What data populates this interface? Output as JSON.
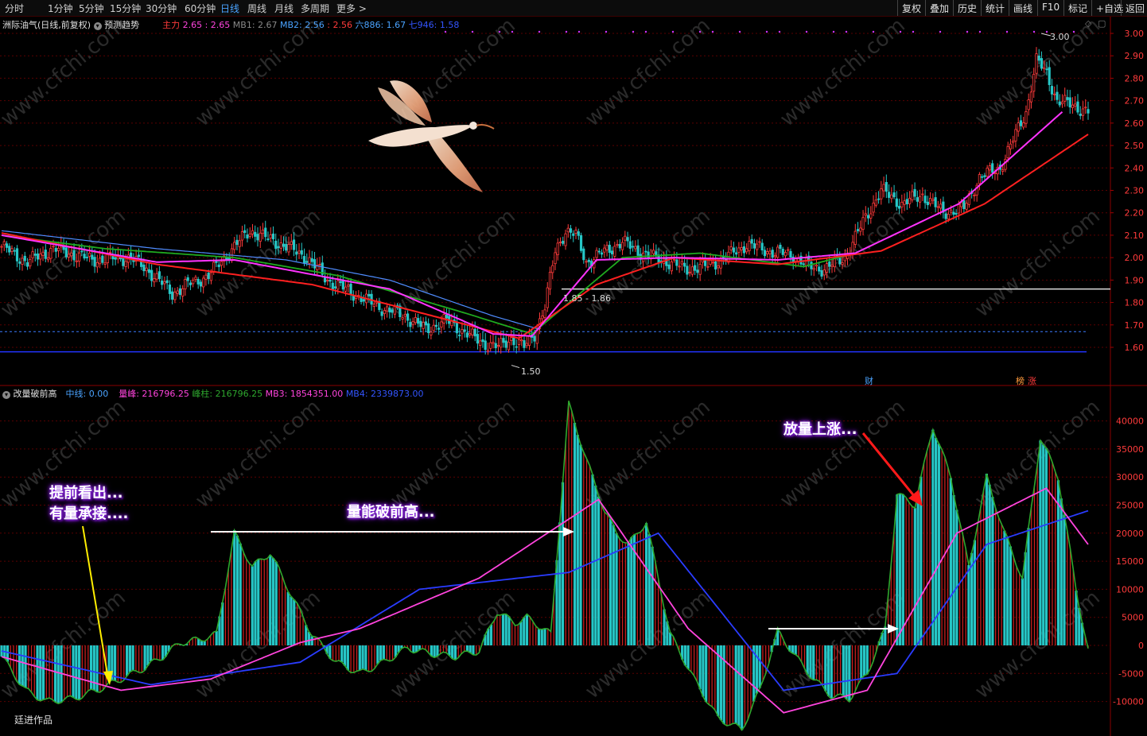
{
  "toolbar": {
    "periods": [
      "分时",
      "1分钟",
      "5分钟",
      "15分钟",
      "30分钟",
      "60分钟",
      "日线",
      "周线",
      "月线",
      "多周期",
      "更多 >"
    ],
    "active_period": "日线",
    "right_buttons": [
      "复权",
      "叠加",
      "历史",
      "统计",
      "画线",
      "F10",
      "标记",
      "+自选",
      "返回"
    ]
  },
  "main_info": {
    "title": "洲际油气(日线,前复权)",
    "trend_label": "预测趋势",
    "zhuli_label": "主力",
    "zhuli_val": "2.65 : 2.65",
    "mb1": "MB1: 2.67",
    "mb2_label": "MB2: 2.56",
    "mb2_val": ": 2.56",
    "liu": "六886: 1.67",
    "qi": "七946: 1.58"
  },
  "sub_info": {
    "title": "改量破前高",
    "zhongxian": "中线: 0.00",
    "liangfeng": "量峰: 216796.25",
    "fengzhu": "峰柱: 216796.25",
    "mb3": "MB3: 1854351.00",
    "mb4": "MB4: 2339873.00"
  },
  "tags": {
    "cai": "财",
    "bang": "榜",
    "zhang": "涨",
    "range": "1.85 - 1.86",
    "high": "3.00",
    "low": "1.50",
    "author": "廷进作品"
  },
  "annotations": {
    "a1_line1": "提前看出...",
    "a1_line2": "有量承接....",
    "a2": "量能破前高...",
    "a3": "放量上涨..."
  },
  "colors": {
    "up": "#ff3b3b",
    "down": "#26c6c6",
    "ma_red": "#ff2020",
    "ma_magenta": "#ff33ff",
    "ma_green": "#1faa1f",
    "ma_blue": "#4f8cff",
    "vol_green_line": "#2ea82e",
    "sub_magenta": "#ff44dd",
    "sub_blue": "#2a3cff"
  },
  "chart_data": [
    {
      "type": "candlestick",
      "title": "洲际油气(日线,前复权)",
      "y_ticks": [
        "3.00",
        "2.90",
        "2.80",
        "2.70",
        "2.60",
        "2.50",
        "2.40",
        "2.30",
        "2.20",
        "2.10",
        "2.00",
        "1.90",
        "1.80",
        "1.70",
        "1.60"
      ],
      "ylim": [
        1.55,
        3.02
      ],
      "price_points": [
        [
          0,
          2.05
        ],
        [
          10,
          1.98
        ],
        [
          20,
          2.04
        ],
        [
          35,
          1.99
        ],
        [
          50,
          2.0
        ],
        [
          58,
          1.93
        ],
        [
          66,
          1.84
        ],
        [
          72,
          1.88
        ],
        [
          80,
          1.92
        ],
        [
          90,
          2.05
        ],
        [
          96,
          2.12
        ],
        [
          102,
          2.09
        ],
        [
          110,
          2.05
        ],
        [
          118,
          2.0
        ],
        [
          126,
          1.9
        ],
        [
          136,
          1.84
        ],
        [
          146,
          1.78
        ],
        [
          156,
          1.74
        ],
        [
          164,
          1.68
        ],
        [
          172,
          1.72
        ],
        [
          180,
          1.66
        ],
        [
          186,
          1.62
        ],
        [
          192,
          1.6
        ],
        [
          197,
          1.64
        ],
        [
          202,
          1.6
        ],
        [
          206,
          1.66
        ],
        [
          210,
          1.78
        ],
        [
          214,
          2.03
        ],
        [
          218,
          2.12
        ],
        [
          222,
          2.1
        ],
        [
          226,
          1.98
        ],
        [
          232,
          2.02
        ],
        [
          240,
          2.07
        ],
        [
          246,
          2.03
        ],
        [
          252,
          2.0
        ],
        [
          258,
          1.98
        ],
        [
          264,
          1.95
        ],
        [
          272,
          1.96
        ],
        [
          280,
          2.0
        ],
        [
          288,
          2.06
        ],
        [
          296,
          2.03
        ],
        [
          306,
          2.01
        ],
        [
          312,
          1.96
        ],
        [
          318,
          1.95
        ],
        [
          326,
          2.0
        ],
        [
          334,
          2.18
        ],
        [
          340,
          2.3
        ],
        [
          348,
          2.24
        ],
        [
          356,
          2.28
        ],
        [
          364,
          2.2
        ],
        [
          372,
          2.22
        ],
        [
          378,
          2.36
        ],
        [
          386,
          2.4
        ],
        [
          392,
          2.55
        ],
        [
          396,
          2.65
        ],
        [
          400,
          2.88
        ],
        [
          404,
          2.82
        ],
        [
          408,
          2.7
        ],
        [
          414,
          2.68
        ],
        [
          420,
          2.65
        ]
      ],
      "ma_fast_points": [
        [
          0,
          2.1
        ],
        [
          60,
          1.98
        ],
        [
          90,
          1.99
        ],
        [
          150,
          1.86
        ],
        [
          190,
          1.66
        ],
        [
          205,
          1.65
        ],
        [
          230,
          1.99
        ],
        [
          260,
          2.0
        ],
        [
          300,
          1.99
        ],
        [
          330,
          2.02
        ],
        [
          370,
          2.24
        ],
        [
          410,
          2.65
        ]
      ],
      "ma_slow_points": [
        [
          0,
          2.11
        ],
        [
          60,
          1.97
        ],
        [
          120,
          1.88
        ],
        [
          180,
          1.7
        ],
        [
          200,
          1.64
        ],
        [
          230,
          1.88
        ],
        [
          260,
          2.0
        ],
        [
          300,
          1.97
        ],
        [
          340,
          2.03
        ],
        [
          380,
          2.24
        ],
        [
          420,
          2.55
        ]
      ],
      "ma_green_points": [
        [
          0,
          2.1
        ],
        [
          40,
          2.04
        ],
        [
          90,
          2.0
        ],
        [
          130,
          1.92
        ],
        [
          180,
          1.75
        ],
        [
          205,
          1.66
        ],
        [
          240,
          2.0
        ],
        [
          270,
          2.02
        ],
        [
          310,
          1.96
        ],
        [
          330,
          2.02
        ]
      ],
      "ma_blue_points": [
        [
          0,
          2.12
        ],
        [
          60,
          2.04
        ],
        [
          110,
          1.99
        ],
        [
          150,
          1.9
        ],
        [
          190,
          1.74
        ],
        [
          208,
          1.68
        ]
      ],
      "horizontal_levels": {
        "range_line": 1.86,
        "dashed_line": 1.67,
        "blue_line": 1.58
      },
      "extremes": {
        "high": 3.0,
        "low": 1.5
      }
    },
    {
      "type": "bar",
      "title": "改量破前高",
      "y_ticks": [
        "40000",
        "35000",
        "30000",
        "25000",
        "20000",
        "15000",
        "10000",
        "5000",
        "0",
        "-5000",
        "-10000"
      ],
      "ylim": [
        -15000,
        44000
      ],
      "bar_points": [
        [
          0,
          -2000
        ],
        [
          8,
          -8000
        ],
        [
          15,
          -10000
        ],
        [
          24,
          -9500
        ],
        [
          32,
          -8000
        ],
        [
          40,
          -6000
        ],
        [
          48,
          -4000
        ],
        [
          54,
          -2000
        ],
        [
          60,
          500
        ],
        [
          66,
          1000
        ],
        [
          72,
          2000
        ],
        [
          78,
          20000
        ],
        [
          84,
          14000
        ],
        [
          90,
          16500
        ],
        [
          98,
          8000
        ],
        [
          104,
          2000
        ],
        [
          112,
          -3000
        ],
        [
          120,
          -5000
        ],
        [
          128,
          -3000
        ],
        [
          136,
          -500
        ],
        [
          144,
          -1500
        ],
        [
          152,
          -2000
        ],
        [
          160,
          -1000
        ],
        [
          166,
          6000
        ],
        [
          172,
          4000
        ],
        [
          176,
          5000
        ],
        [
          184,
          2000
        ],
        [
          190,
          43000
        ],
        [
          196,
          33000
        ],
        [
          202,
          24000
        ],
        [
          206,
          20000
        ],
        [
          210,
          18000
        ],
        [
          216,
          22000
        ],
        [
          224,
          2000
        ],
        [
          232,
          -6000
        ],
        [
          240,
          -13000
        ],
        [
          248,
          -15000
        ],
        [
          254,
          -8000
        ],
        [
          260,
          2500
        ],
        [
          266,
          -2000
        ],
        [
          272,
          -6000
        ],
        [
          278,
          -9000
        ],
        [
          284,
          -9500
        ],
        [
          290,
          -5000
        ],
        [
          296,
          3000
        ],
        [
          300,
          27000
        ],
        [
          306,
          25000
        ],
        [
          312,
          39000
        ],
        [
          318,
          30000
        ],
        [
          324,
          14000
        ],
        [
          330,
          30000
        ],
        [
          336,
          20000
        ],
        [
          342,
          12000
        ],
        [
          348,
          37000
        ],
        [
          354,
          30000
        ],
        [
          360,
          10000
        ],
        [
          364,
          -1000
        ]
      ],
      "ma_magenta_points": [
        [
          0,
          -2000
        ],
        [
          40,
          -8000
        ],
        [
          70,
          -6000
        ],
        [
          100,
          500
        ],
        [
          120,
          3000
        ],
        [
          160,
          12000
        ],
        [
          200,
          26000
        ],
        [
          230,
          3000
        ],
        [
          262,
          -12000
        ],
        [
          290,
          -8000
        ],
        [
          320,
          20000
        ],
        [
          350,
          28000
        ],
        [
          364,
          18000
        ]
      ],
      "ma_blue_points": [
        [
          0,
          -1000
        ],
        [
          50,
          -7000
        ],
        [
          100,
          -3000
        ],
        [
          140,
          10000
        ],
        [
          190,
          13000
        ],
        [
          220,
          20000
        ],
        [
          262,
          -8000
        ],
        [
          300,
          -5000
        ],
        [
          330,
          18000
        ],
        [
          364,
          24000
        ]
      ]
    }
  ]
}
